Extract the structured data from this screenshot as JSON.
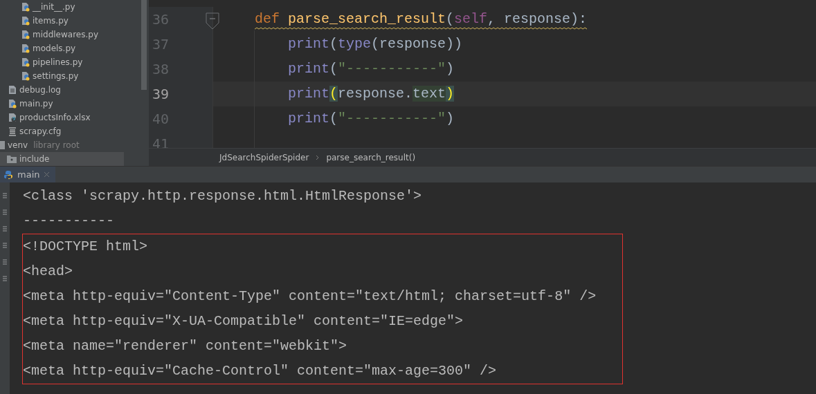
{
  "project_tree": {
    "nested_files": [
      {
        "label": "__init__.py",
        "kind": "python"
      },
      {
        "label": "items.py",
        "kind": "python"
      },
      {
        "label": "middlewares.py",
        "kind": "python"
      },
      {
        "label": "models.py",
        "kind": "python"
      },
      {
        "label": "pipelines.py",
        "kind": "python"
      },
      {
        "label": "settings.py",
        "kind": "python"
      }
    ],
    "files": [
      {
        "label": "debug.log",
        "kind": "text"
      },
      {
        "label": "main.py",
        "kind": "python"
      },
      {
        "label": "productsInfo.xlsx",
        "kind": "unknown"
      },
      {
        "label": "scrapy.cfg",
        "kind": "config"
      }
    ],
    "venv": {
      "label": "venv",
      "note": "library root",
      "children": [
        {
          "label": "include",
          "kind": "folder",
          "selected": true
        }
      ]
    }
  },
  "editor": {
    "lines": [
      {
        "number": "36",
        "current": false,
        "warning": true,
        "kind": "def",
        "tokens": [
          {
            "kind": "keyword",
            "s": "def"
          },
          {
            "kind": "function",
            "s": "parse_search_result"
          },
          {
            "kind": "plain",
            "s": "("
          },
          {
            "kind": "self",
            "s": "self"
          },
          {
            "kind": "plain",
            "s": ", response):"
          }
        ]
      },
      {
        "number": "37",
        "current": false,
        "warning": false,
        "kind": "body",
        "tokens": [
          {
            "kind": "builtin",
            "s": "print"
          },
          {
            "kind": "plain",
            "s": "("
          },
          {
            "kind": "builtin",
            "s": "type"
          },
          {
            "kind": "plain",
            "s": "(response))"
          }
        ]
      },
      {
        "number": "38",
        "current": false,
        "warning": false,
        "kind": "body",
        "tokens": [
          {
            "kind": "builtin",
            "s": "print"
          },
          {
            "kind": "plain",
            "s": "("
          },
          {
            "kind": "string",
            "s": "\"-----------\""
          },
          {
            "kind": "plain",
            "s": ")"
          }
        ]
      },
      {
        "number": "39",
        "current": true,
        "warning": false,
        "kind": "body",
        "tokens": [
          {
            "kind": "builtin",
            "s": "print"
          },
          {
            "kind": "brace",
            "s": "("
          },
          {
            "kind": "plain",
            "s": "response."
          },
          {
            "kind": "match",
            "s": "text"
          },
          {
            "kind": "brace",
            "s": ")"
          }
        ]
      },
      {
        "number": "40",
        "current": false,
        "warning": false,
        "kind": "body",
        "tokens": [
          {
            "kind": "builtin",
            "s": "print"
          },
          {
            "kind": "plain",
            "s": "("
          },
          {
            "kind": "string",
            "s": "\"-----------\""
          },
          {
            "kind": "plain",
            "s": ")"
          }
        ]
      },
      {
        "number": "41",
        "current": false
      }
    ],
    "breadcrumb": [
      "JdSearchSpiderSpider",
      "parse_search_result()"
    ]
  },
  "run_panel": {
    "tab": {
      "label": "main",
      "selected": true
    },
    "output_before": [
      "<class 'scrapy.http.response.html.HtmlResponse'>",
      "-----------"
    ],
    "boxed_output": [
      "<!DOCTYPE html>",
      "<head>",
      "<meta http-equiv=\"Content-Type\" content=\"text/html; charset=utf-8\" />",
      "<meta http-equiv=\"X-UA-Compatible\" content=\"IE=edge\">",
      "<meta name=\"renderer\" content=\"webkit\">",
      "<meta http-equiv=\"Cache-Control\" content=\"max-age=300\" />"
    ]
  }
}
